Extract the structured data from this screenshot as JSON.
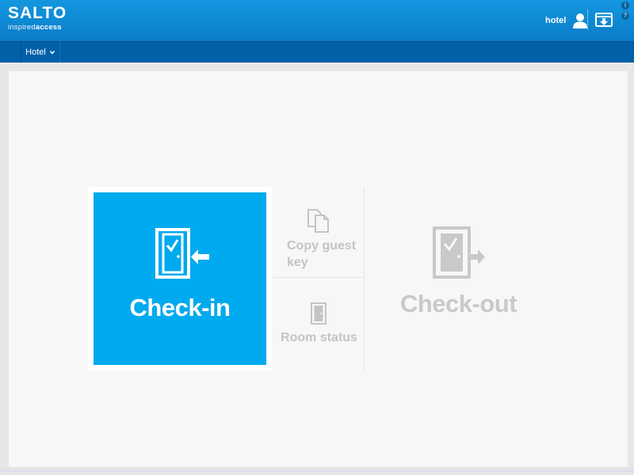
{
  "brand": {
    "name": "SALTO",
    "tagline_light": "inspired",
    "tagline_bold": "access"
  },
  "header": {
    "user_name": "hotel",
    "info_glyph": "i",
    "help_glyph": "?",
    "icons": [
      "user-icon",
      "download-icon",
      "info-icon",
      "help-icon"
    ]
  },
  "nav": {
    "items": [
      {
        "label": "Hotel",
        "icon": "chevron-down-icon"
      }
    ]
  },
  "tiles": {
    "checkin": {
      "label": "Check-in",
      "icon": "door-checkin-icon"
    },
    "copy_key": {
      "label": "Copy guest key",
      "icon": "copy-documents-icon"
    },
    "room_status": {
      "label": "Room status",
      "icon": "door-small-icon"
    },
    "checkout": {
      "label": "Check-out",
      "icon": "door-checkout-icon"
    }
  },
  "colors": {
    "header_blue": "#0a86d6",
    "nav_blue": "#0060a8",
    "accent_tile": "#00aaee",
    "inactive_text": "#c4c4c4",
    "panel_bg": "#f7f7f7"
  }
}
